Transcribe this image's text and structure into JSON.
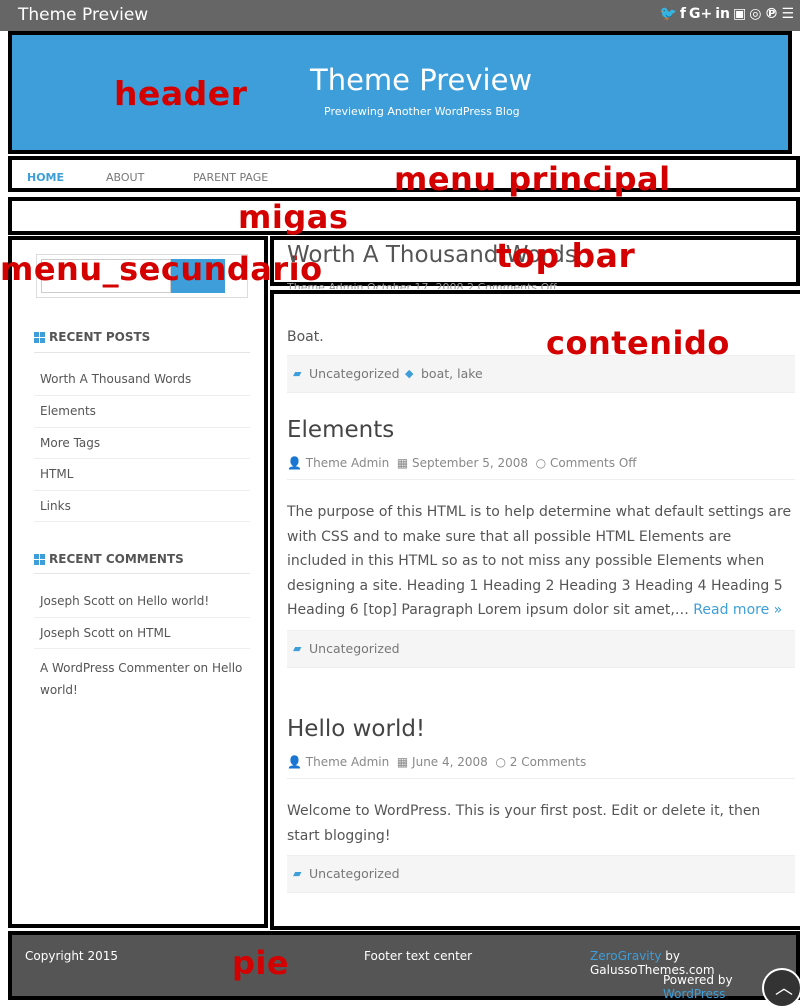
{
  "site": {
    "bar_title": "Theme Preview",
    "title": "Theme Preview",
    "description": "Previewing Another WordPress Blog"
  },
  "social": [
    "🐦",
    "f",
    "G+",
    "in",
    "▣",
    "◎",
    "℗",
    "☰"
  ],
  "menu": {
    "items": [
      {
        "label": "HOME",
        "active": true
      },
      {
        "label": "ABOUT"
      },
      {
        "label": "PARENT PAGE"
      }
    ]
  },
  "annotations": {
    "header": "header",
    "menu_principal": "menu principal",
    "migas": "migas",
    "menu_secundario": "menu_secundario",
    "top_bar": "top bar",
    "contenido": "contenido",
    "pie": "pie"
  },
  "sidebar": {
    "recent_posts_title": "RECENT POSTS",
    "recent_posts": [
      "Worth A Thousand Words",
      "Elements",
      "More Tags",
      "HTML",
      "Links"
    ],
    "recent_comments_title": "RECENT COMMENTS",
    "recent_comments": [
      "Joseph Scott on Hello world!",
      "Joseph Scott on HTML",
      "A WordPress Commenter on Hello world!"
    ]
  },
  "posts": [
    {
      "title": "Worth A Thousand Words",
      "meta": "Theme Admin  October 17, 2008  2 Comments Off",
      "text": "Boat.",
      "category": "Uncategorized",
      "tags": "boat, lake"
    },
    {
      "title": "Elements",
      "author": "Theme Admin",
      "date": "September 5, 2008",
      "comments": "Comments Off",
      "text": "The purpose of this HTML is to help determine what default settings are with CSS and to make sure that all possible HTML Elements are included in this HTML so as to not miss any possible Elements when designing a site. Heading 1 Heading 2 Heading 3 Heading 4 Heading 5 Heading 6 [top] Paragraph Lorem ipsum dolor sit amet,…",
      "read_more": "Read more »",
      "category": "Uncategorized"
    },
    {
      "title": "Hello world!",
      "author": "Theme Admin",
      "date": "June 4, 2008",
      "comments": "2 Comments",
      "text": "Welcome to WordPress. This is your first post. Edit or delete it, then start blogging!",
      "category": "Uncategorized"
    }
  ],
  "footer": {
    "copyright": "Copyright 2015",
    "center": "Footer text center",
    "theme_link": "ZeroGravity",
    "theme_by": " by GalussoThemes.com",
    "powered_by": "Powered by ",
    "powered_link": "WordPress"
  },
  "colors": {
    "accent": "#3d9ed9",
    "annotation": "#d40000",
    "topbar": "#666666",
    "footer": "#555555"
  }
}
